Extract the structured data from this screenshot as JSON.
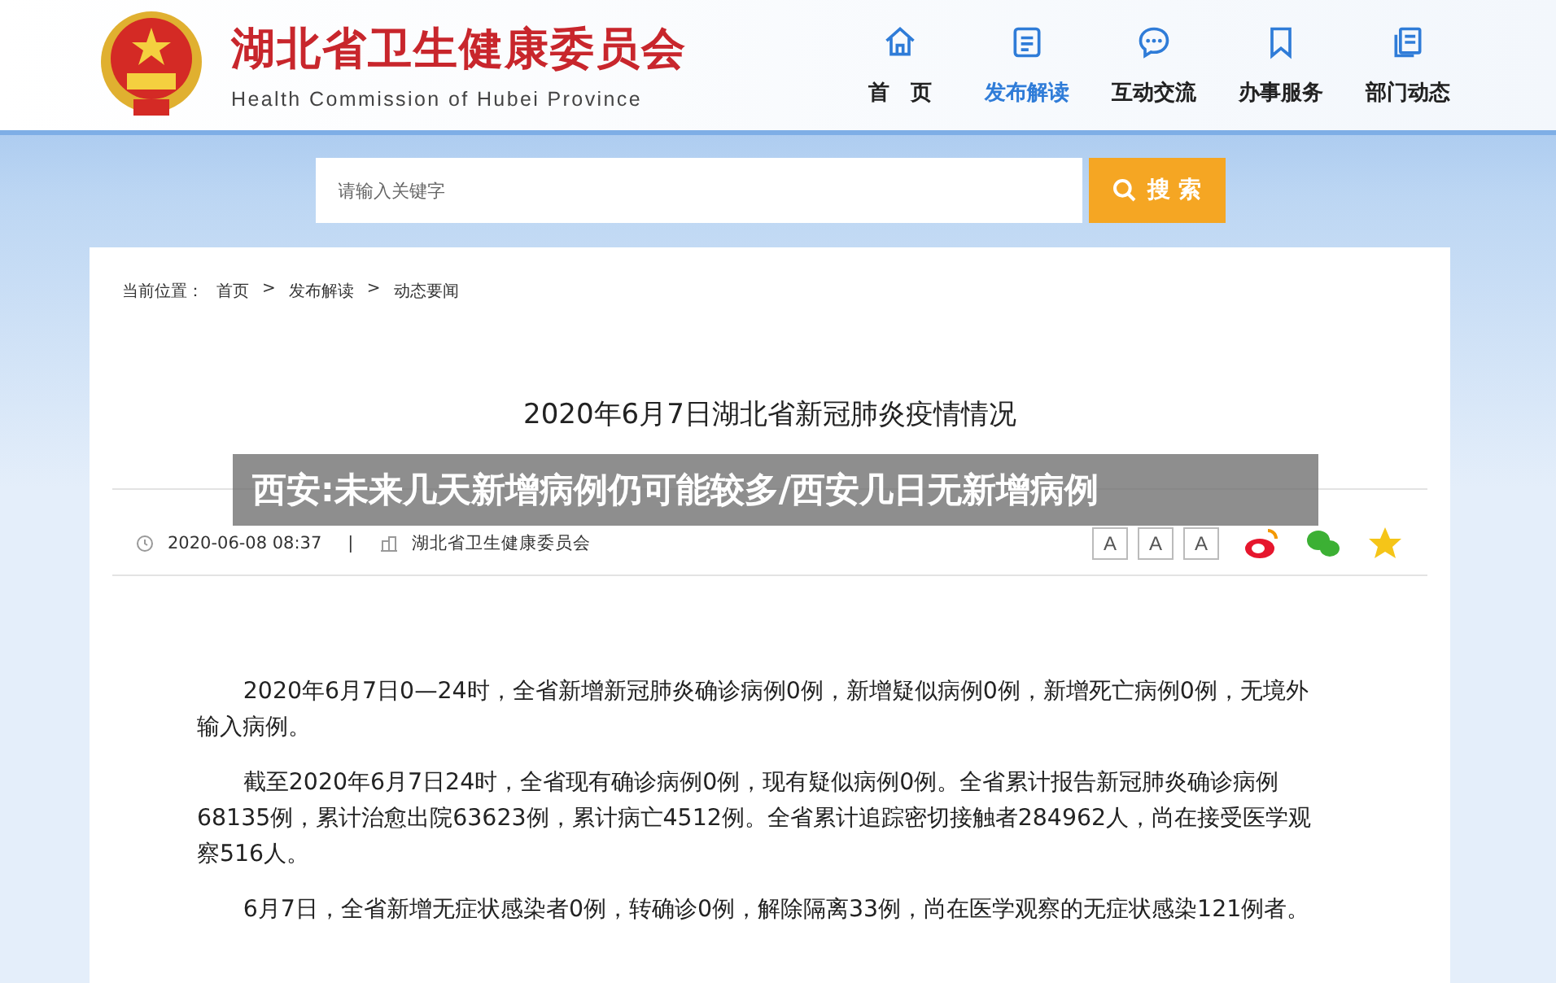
{
  "site": {
    "title": "湖北省卫生健康委员会",
    "subtitle": "Health Commission of Hubei Province"
  },
  "nav": [
    {
      "label": "首　页",
      "selected": false
    },
    {
      "label": "发布解读",
      "selected": true
    },
    {
      "label": "互动交流",
      "selected": false
    },
    {
      "label": "办事服务",
      "selected": false
    },
    {
      "label": "部门动态",
      "selected": false
    }
  ],
  "search": {
    "placeholder": "请输入关键字",
    "button": "搜 索"
  },
  "breadcrumb": {
    "label": "当前位置：",
    "items": [
      "首页",
      "发布解读",
      "动态要闻"
    ],
    "separator": ">"
  },
  "article": {
    "title": "2020年6月7日湖北省新冠肺炎疫情情况",
    "date": "2020-06-08 08:37",
    "divider": "|",
    "source": "湖北省卫生健康委员会",
    "font_buttons": [
      "A",
      "A",
      "A"
    ],
    "paragraphs": [
      "2020年6月7日0—24时，全省新增新冠肺炎确诊病例0例，新增疑似病例0例，新增死亡病例0例，无境外输入病例。",
      "截至2020年6月7日24时，全省现有确诊病例0例，现有疑似病例0例。全省累计报告新冠肺炎确诊病例68135例，累计治愈出院63623例，累计病亡4512例。全省累计追踪密切接触者284962人，尚在接受医学观察516人。",
      "6月7日，全省新增无症状感染者0例，转确诊0例，解除隔离33例，尚在医学观察的无症状感染121例者。"
    ]
  },
  "overlay": {
    "headline": "西安:未来几天新增病例仍可能较多/西安几日无新增病例"
  }
}
